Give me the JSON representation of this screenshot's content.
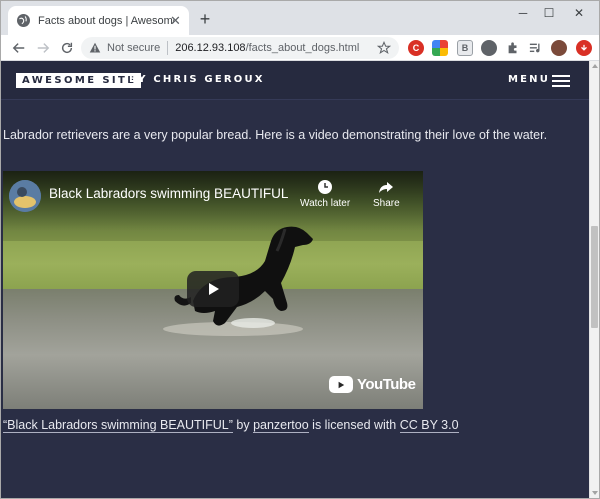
{
  "browser": {
    "tab_title": "Facts about dogs | Awesome Site",
    "tab_close": "✕",
    "new_tab": "+",
    "window_controls": [
      "─",
      "☐",
      "✕"
    ],
    "omnibox": {
      "security_label": "Not secure",
      "url_host": "206.12.93.108",
      "url_path": "/facts_about_dogs.html"
    },
    "extensions": [
      {
        "icon": "red-badge-extension-icon",
        "color": "#d93025",
        "text": "C"
      },
      {
        "icon": "pinwheel-extension-icon",
        "color": "#34a853",
        "text": ""
      },
      {
        "icon": "grey-box-extension-icon",
        "color": "#9aa0a6",
        "text": "B"
      },
      {
        "icon": "dark-circle-extension-icon",
        "color": "#5f6368",
        "text": ""
      },
      {
        "icon": "puzzle-extensions-icon",
        "color": "#5f6368",
        "text": ""
      },
      {
        "icon": "media-control-icon",
        "color": "#5f6368",
        "text": ""
      },
      {
        "icon": "profile-avatar-icon",
        "color": "#7b4a3a",
        "text": ""
      },
      {
        "icon": "update-menu-icon",
        "color": "#d93025",
        "text": ""
      }
    ]
  },
  "site": {
    "logo": "AWESOME SITE",
    "author": "BY CHRIS GEROUX",
    "menu_label": "MENU"
  },
  "content": {
    "intro": "Labrador retrievers are a very popular bread. Here is a video demonstrating their love of the water.",
    "video": {
      "title": "Black Labradors swimming BEAUTIFUL",
      "watch_later": "Watch later",
      "share": "Share",
      "brand": "YouTube"
    },
    "credit": {
      "video_link": "“Black Labradors swimming BEAUTIFUL”",
      "by": " by ",
      "author_link": "panzertoo",
      "licensed": " is licensed with ",
      "license_link": "CC BY 3.0"
    }
  }
}
